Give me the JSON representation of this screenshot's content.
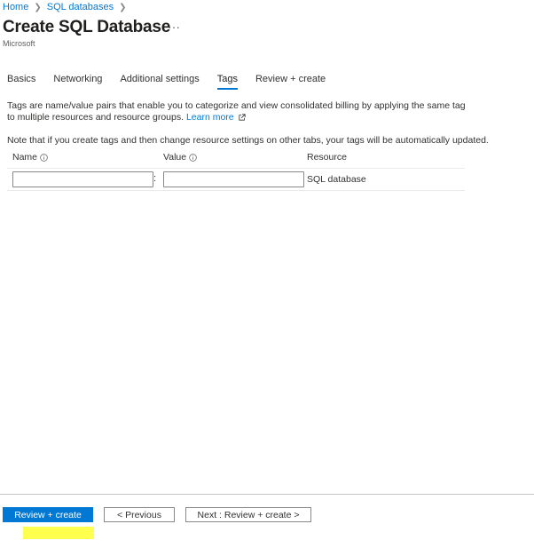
{
  "breadcrumb": {
    "items": [
      "Home",
      "SQL databases"
    ]
  },
  "header": {
    "title": "Create SQL Database",
    "more": "···",
    "subtitle": "Microsoft"
  },
  "tabs": [
    {
      "label": "Basics",
      "active": false
    },
    {
      "label": "Networking",
      "active": false
    },
    {
      "label": "Additional settings",
      "active": false
    },
    {
      "label": "Tags",
      "active": true
    },
    {
      "label": "Review + create",
      "active": false
    }
  ],
  "description": {
    "text": "Tags are name/value pairs that enable you to categorize and view consolidated billing by applying the same tag to multiple resources and resource groups.",
    "link": "Learn more"
  },
  "note": "Note that if you create tags and then change resource settings on other tabs, your tags will be automatically updated.",
  "table": {
    "headers": {
      "name": "Name",
      "value": "Value",
      "resource": "Resource"
    },
    "rows": [
      {
        "name": "",
        "separator": ":",
        "value": "",
        "resource": "SQL database"
      }
    ]
  },
  "footer": {
    "review_create": "Review + create",
    "previous": "< Previous",
    "next": "Next : Review + create >"
  },
  "colors": {
    "accent": "#0078d4",
    "highlight": "#ffff3a"
  }
}
